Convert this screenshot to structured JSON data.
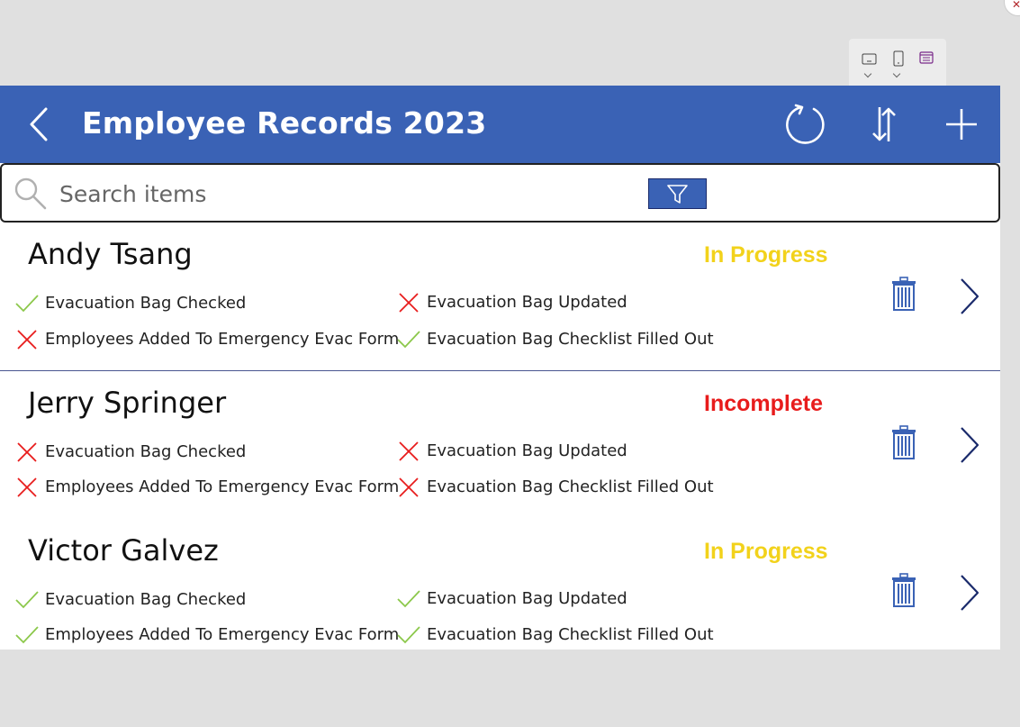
{
  "header": {
    "title": "Employee Records 2023"
  },
  "search": {
    "placeholder": "Search items"
  },
  "records": [
    {
      "name": "Andy Tsang",
      "status": "In Progress",
      "status_color": "#f2d21b",
      "checks": [
        {
          "label": "Evacuation Bag Checked",
          "done": true
        },
        {
          "label": "Evacuation Bag Updated",
          "done": false
        },
        {
          "label": "Employees Added To Emergency Evac Form",
          "done": false
        },
        {
          "label": "Evacuation Bag Checklist Filled Out",
          "done": true
        }
      ]
    },
    {
      "name": "Jerry Springer",
      "status": "Incomplete",
      "status_color": "#e81c1c",
      "checks": [
        {
          "label": "Evacuation Bag Checked",
          "done": false
        },
        {
          "label": "Evacuation Bag Updated",
          "done": false
        },
        {
          "label": "Employees Added To Emergency Evac Form",
          "done": false
        },
        {
          "label": "Evacuation Bag Checklist Filled Out",
          "done": false
        }
      ]
    },
    {
      "name": "Victor Galvez",
      "status": "In Progress",
      "status_color": "#f2d21b",
      "checks": [
        {
          "label": "Evacuation Bag Checked",
          "done": true
        },
        {
          "label": "Evacuation Bag Updated",
          "done": true
        },
        {
          "label": "Employees Added To Emergency Evac Form",
          "done": true
        },
        {
          "label": "Evacuation Bag Checklist Filled Out",
          "done": true
        }
      ]
    }
  ],
  "colors": {
    "accent": "#3a62b5",
    "check_ok": "#8cc84b",
    "check_fail": "#e81c1c",
    "nav": "#1a2a6b"
  },
  "icons": [
    "back-arrow-icon",
    "refresh-icon",
    "sort-icon",
    "add-icon",
    "search-icon",
    "filter-icon",
    "trash-icon",
    "chevron-right-icon",
    "checkmark-icon",
    "cross-icon"
  ]
}
